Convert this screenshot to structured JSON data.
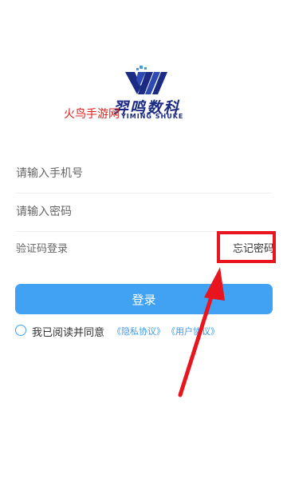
{
  "logo": {
    "name_cn": "羿鸣数科",
    "name_en": "YIMING SHUKE"
  },
  "watermark": "火鸟手游网",
  "form": {
    "phone_placeholder": "请输入手机号",
    "password_placeholder": "请输入密码",
    "sms_login_label": "验证码登录",
    "forgot_password_label": "忘记密码",
    "login_button_label": "登录"
  },
  "agreement": {
    "text": "我已阅读并同意",
    "privacy_link": "《隐私协议》",
    "user_link": "《用户协议》"
  },
  "colors": {
    "accent": "#41a2f4",
    "annotation": "#e8141e",
    "brand": "#1b2a82"
  },
  "icons": [
    "yiming-logo-icon",
    "radio-unchecked-icon",
    "annotation-arrow-icon"
  ]
}
